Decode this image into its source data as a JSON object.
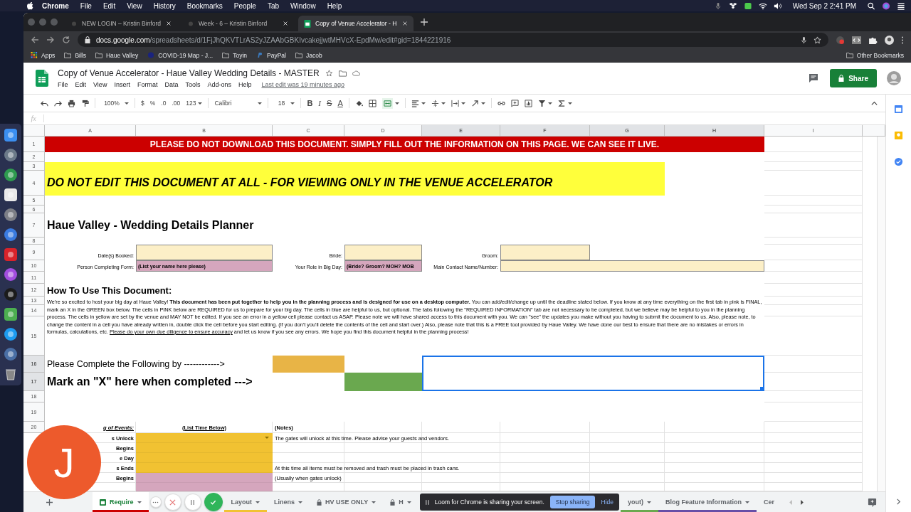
{
  "menubar": {
    "app": "Chrome",
    "menus": [
      "File",
      "Edit",
      "View",
      "History",
      "Bookmarks",
      "People",
      "Tab",
      "Window",
      "Help"
    ],
    "clock": "Wed Sep 2  2:41 PM"
  },
  "browser": {
    "tabs": [
      {
        "title": "NEW LOGIN – Kristin Binford",
        "selected": false
      },
      {
        "title": "Week - 6 – Kristin Binford",
        "selected": false
      },
      {
        "title": "Copy of Venue Accelerator - H",
        "selected": true
      }
    ],
    "url_domain": "docs.google.com",
    "url_path": "/spreadsheets/d/1FjJhQKVTLrAS2yJZAAbGBKIvcakejjwtMHVcX-EpdMw/edit#gid=1844221916",
    "bookmarks": [
      {
        "label": "Apps",
        "kind": "apps"
      },
      {
        "label": "Bills",
        "kind": "folder"
      },
      {
        "label": "Haue Valley",
        "kind": "folder"
      },
      {
        "label": "COVID-19 Map - J...",
        "kind": "site"
      },
      {
        "label": "Toyin",
        "kind": "folder"
      },
      {
        "label": "PayPal",
        "kind": "paypal"
      },
      {
        "label": "Jacob",
        "kind": "folder"
      }
    ],
    "other_bookmarks": "Other Bookmarks"
  },
  "doc": {
    "title": "Copy of Venue Accelerator - Haue Valley Wedding Details - MASTER",
    "menus": [
      "File",
      "Edit",
      "View",
      "Insert",
      "Format",
      "Data",
      "Tools",
      "Add-ons",
      "Help"
    ],
    "last_edit": "Last edit was 19 minutes ago",
    "share": "Share"
  },
  "toolbar": {
    "zoom": "100%",
    "currency": "$",
    "percent": "%",
    "decimal_less": ".0",
    "decimal_more": ".00",
    "number_format": "123",
    "font": "Calibri",
    "font_size": "18",
    "bold": "B",
    "italic": "I",
    "strike": "S",
    "text_color": "A"
  },
  "formula_bar": {
    "label": "fx"
  },
  "columns": [
    {
      "label": "A",
      "selected": false
    },
    {
      "label": "B",
      "selected": false
    },
    {
      "label": "C",
      "selected": false
    },
    {
      "label": "D",
      "selected": false
    },
    {
      "label": "E",
      "selected": true
    },
    {
      "label": "F",
      "selected": true
    },
    {
      "label": "G",
      "selected": true
    },
    {
      "label": "H",
      "selected": true
    },
    {
      "label": "I",
      "selected": false
    }
  ],
  "rows": [
    {
      "label": "1",
      "selected": false
    },
    {
      "label": "2",
      "selected": false
    },
    {
      "label": "3",
      "selected": false
    },
    {
      "label": "4",
      "selected": false
    },
    {
      "label": "5",
      "selected": false
    },
    {
      "label": "6",
      "selected": false
    },
    {
      "label": "7",
      "selected": false
    },
    {
      "label": "8",
      "selected": false
    },
    {
      "label": "9",
      "selected": false
    },
    {
      "label": "10",
      "selected": false
    },
    {
      "label": "11",
      "selected": false
    },
    {
      "label": "12",
      "selected": false
    },
    {
      "label": "13",
      "selected": false
    },
    {
      "label": "14",
      "selected": false
    },
    {
      "label": "15",
      "selected": false
    },
    {
      "label": "16",
      "selected": true
    },
    {
      "label": "17",
      "selected": true
    },
    {
      "label": "18",
      "selected": false
    },
    {
      "label": "19",
      "selected": false
    },
    {
      "label": "20",
      "selected": false
    }
  ],
  "banner": "PLEASE DO NOT DOWNLOAD THIS DOCUMENT. SIMPLY FILL OUT THE INFORMATION ON THIS PAGE. WE CAN SEE IT LIVE.",
  "warning": "DO NOT EDIT THIS DOCUMENT AT ALL - FOR VIEWING ONLY IN THE VENUE ACCELERATOR",
  "heading": "Haue Valley - Wedding Details Planner",
  "form": [
    {
      "label": "Date(s) Booked:",
      "color": "#fcefc7"
    },
    {
      "label": "Bride:",
      "color": "#fcefc7"
    },
    {
      "label": "Groom:",
      "color": "#fcefc7"
    },
    {
      "label": "Person Completing Form:",
      "value": "(List your name here please)",
      "color": "#d5a6bd"
    },
    {
      "label": "Your Role in Big Day:",
      "value": "(Bride? Groom? MOH? MOB",
      "color": "#d5a6bd"
    },
    {
      "label": "Main Contact Name/Number:",
      "color": "#fcefc7"
    }
  ],
  "section_title": "How To Use This Document:",
  "instructions": {
    "text": "We're so excited to host your big day at Haue Valley! **This document has been put together to help you in the planning process and is designed for use on a desktop computer.** You can add/edit/change up until the deadline stated below. If you know at any time everything on the first tab in pink is FINAL, mark an X in the GREEN box below. The cells in PINK below are REQUIRED for us to prepare for your big day. The cells in blue are helpful to us, but optional. The tabs following the \"REQUIRED INFORMATION\" tab are not necessary to be completed, but we believe may be helpful to you in the planning process. The cells in yellow are set by the venue and MAY NOT be edited. If you see an error in a yellow cell please contact us ASAP. Please note we will have shared access to this document with you.  We can \"see\" the updates you make without you having to submit the document to us. Also, please note, to change the content in a cell you have already written in, double click the cell before you start editing. (If you don't you'll delete the contents of the cell and start over.) Also, please note that this is a FREE tool provided by Haue Valley. We have done our best to ensure that there are no mistakes or errors in formulas, calculations, etc. ",
    "underlined": "Please do your own due diligence to ensure accuracy",
    "after": " and let us know if you see any errors. We hope you find this document helpful in the planning process!"
  },
  "deadline": {
    "label": "Please Complete the Following by ------------>",
    "color": "#e8b446"
  },
  "completion": {
    "label": "Mark an \"X\" here when completed --->",
    "color": "#6aa84f"
  },
  "schedule": {
    "event_header": "g of Events:",
    "time_header": "(List Time Below)",
    "notes_header": "(Notes)",
    "items": [
      {
        "event": "s Unlock",
        "color": "#f1c232",
        "note": "The gates will  unlock at this time. Please advise your guests and vendors."
      },
      {
        "event": "Begins",
        "color": "#f1c232"
      },
      {
        "event": "e Day",
        "color": "#f1c232"
      },
      {
        "event": "s Ends",
        "color": "#f1c232",
        "note": "At this time all items must be removed and trash must be placed in trash cans."
      },
      {
        "event": "Begins",
        "color": "#d5a6bd",
        "note": "(Usually when gates unlock)"
      },
      {
        "color": "#d5a6bd"
      }
    ]
  },
  "sheet_tabs": [
    {
      "label": "Require",
      "color": "#cc0000",
      "selected": true,
      "locked": false
    },
    {
      "label": "Layout",
      "color": "#f1c232",
      "selected": false,
      "locked": false
    },
    {
      "label": "Linens",
      "selected": false,
      "locked": false
    },
    {
      "label": "HV USE ONLY",
      "selected": false,
      "locked": true
    },
    {
      "label": "H",
      "selected": false,
      "locked": true
    },
    {
      "label": "yout)",
      "color": "#6aa84f",
      "selected": false,
      "locked": false
    },
    {
      "label": "Blog Feature Information",
      "color": "#674ea7",
      "selected": false,
      "locked": false
    },
    {
      "label": "Cer",
      "selected": false,
      "locked": false
    }
  ],
  "loom": {
    "avatar": "J",
    "message": "Loom for Chrome is sharing your screen.",
    "stop": "Stop sharing",
    "hide": "Hide"
  }
}
